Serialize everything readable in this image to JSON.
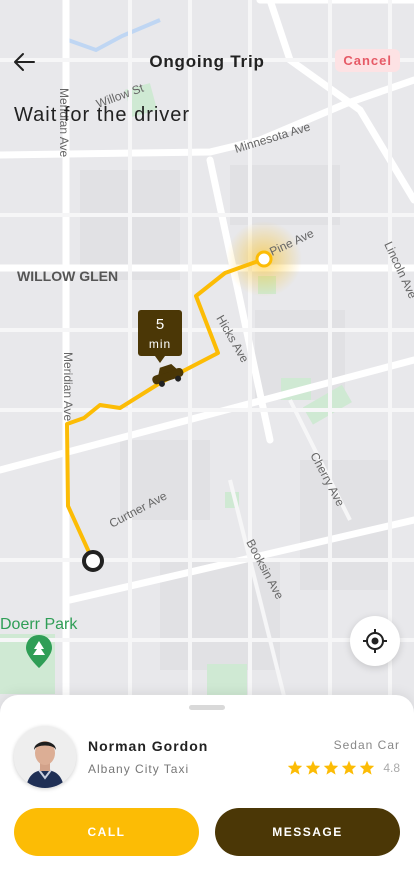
{
  "header": {
    "title": "Ongoing Trip",
    "cancel_label": "Cancel",
    "back_icon": "back-arrow-icon"
  },
  "heading": "Wait for the driver",
  "map": {
    "labels": {
      "willow_st": "Willow St",
      "minnesota_ave": "Minnesota Ave",
      "meridian_ave_top": "Meridian Ave",
      "meridian_ave_bottom": "Meridian Ave",
      "willow_glen": "WILLOW GLEN",
      "pine_ave": "Pine Ave",
      "lincoln_ave": "Lincoln Ave",
      "hicks_ave": "Hicks Ave",
      "cherry_ave": "Cherry Ave",
      "curtner_ave": "Curtner Ave",
      "booksin_ave": "Booksin Ave",
      "doerr_park": "Doerr Park"
    },
    "eta": {
      "value": "5",
      "unit": "min"
    },
    "route_color": "#fcbc05",
    "locate_icon": "crosshair-icon"
  },
  "driver": {
    "name": "Norman Gordon",
    "company": "Albany City Taxi",
    "car_type": "Sedan Car",
    "rating": "4.8",
    "stars_filled": 5
  },
  "actions": {
    "call_label": "CALL",
    "message_label": "MESSAGE"
  },
  "colors": {
    "accent": "#fcbc05",
    "dark": "#4b3706",
    "cancel": "#e65a66"
  }
}
